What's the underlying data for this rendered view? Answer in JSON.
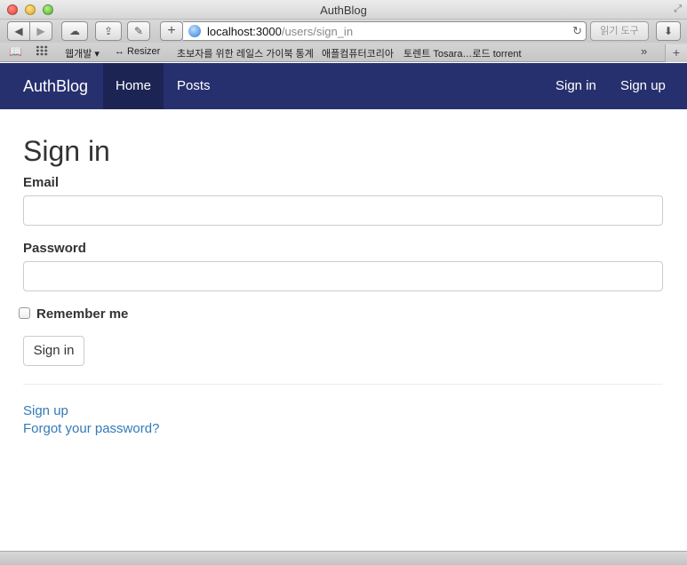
{
  "window": {
    "title": "AuthBlog"
  },
  "address_bar": {
    "url_host": "localhost:3000",
    "url_path": "/users/sign_in"
  },
  "toolbar": {
    "reader_label": "읽기 도구"
  },
  "bookmarks": [
    "웹개발 ▾",
    "↔ Resizer",
    "초보자를 위한 레일스 가이북 통계",
    "애플컴퓨터코리아",
    "토렌트 Tosara…로드 torrent"
  ],
  "navbar": {
    "brand": "AuthBlog",
    "home": "Home",
    "posts": "Posts",
    "sign_in": "Sign in",
    "sign_up": "Sign up",
    "background": "#27306e",
    "active_background": "#1c2454"
  },
  "form": {
    "heading": "Sign in",
    "email_label": "Email",
    "email_value": "",
    "password_label": "Password",
    "password_value": "",
    "remember_label": "Remember me",
    "remember_checked": false,
    "submit_label": "Sign in"
  },
  "links": {
    "sign_up": "Sign up",
    "forgot_password": "Forgot your password?",
    "color": "#337ab7"
  },
  "icons": {
    "back": "◀",
    "forward": "▶",
    "icloud": "☁",
    "share": "⇪",
    "tools": "✎",
    "add": "+",
    "reload": "↻",
    "download": "⬇",
    "reading_list": "📖",
    "overflow": "»",
    "new_tab": "+",
    "fullscreen": "⤢"
  }
}
